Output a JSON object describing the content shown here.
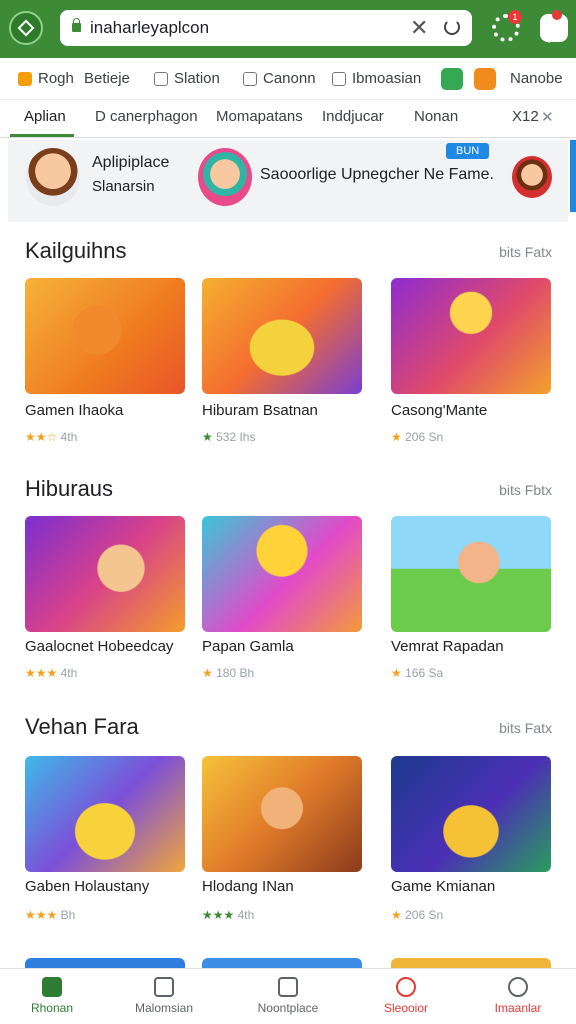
{
  "browser": {
    "url": "inaharleyaplcon",
    "notif_count": "1"
  },
  "categories": [
    {
      "label": "Rogh",
      "icon": "app-icon"
    },
    {
      "label": "Betieje",
      "icon": "grid-icon"
    },
    {
      "label": "Slation",
      "icon": "image-icon"
    },
    {
      "label": "Canonn",
      "icon": "camera-icon"
    },
    {
      "label": "Ibmoasian",
      "icon": "box-icon"
    },
    {
      "label": "Nanobe",
      "icon": "more-icon"
    }
  ],
  "tabs": [
    {
      "label": "Aplian"
    },
    {
      "label": "D canerphagon"
    },
    {
      "label": "Momapatans"
    },
    {
      "label": "Inddjucar"
    },
    {
      "label": "Nonan"
    },
    {
      "label": "X12"
    }
  ],
  "banner": {
    "title": "Aplipiplace",
    "subtitle": "Slanarsin",
    "middle_text": "Saooorlige Upnegcher Ne Fame.",
    "badge": "BUN"
  },
  "sections": [
    {
      "title": "Kailguihns",
      "more": "bits Fatx",
      "cards": [
        {
          "title": "Gamen Ihaoka",
          "stars": "★★☆",
          "rating": "4th"
        },
        {
          "title": "Hiburam Bsatnan",
          "stars": "★",
          "rating": "532 Ihs"
        },
        {
          "title": "Casong'Mante",
          "stars": "★",
          "rating": "206 Sn"
        }
      ]
    },
    {
      "title": "Hiburaus",
      "more": "bits Fbtx",
      "cards": [
        {
          "title": "Gaalocnet Hobeedcay",
          "stars": "★★★",
          "rating": "4th"
        },
        {
          "title": "Papan Gamla",
          "stars": "★",
          "rating": "180 Bh"
        },
        {
          "title": "Vemrat Rapadan",
          "stars": "★",
          "rating": "166 Sa"
        }
      ]
    },
    {
      "title": "Vehan Fara",
      "more": "bits Fatx",
      "cards": [
        {
          "title": "Gaben Holaustany",
          "stars": "★★★",
          "rating": "Bh"
        },
        {
          "title": "Hlodang INan",
          "stars": "★★★",
          "rating": "4th"
        },
        {
          "title": "Game Kmianan",
          "stars": "★",
          "rating": "206 Sn"
        }
      ]
    }
  ],
  "bottom_nav": [
    {
      "label": "Rhonan"
    },
    {
      "label": "Malomsian"
    },
    {
      "label": "Noontplace"
    },
    {
      "label": "Sleooior"
    },
    {
      "label": "Imaanlar"
    }
  ],
  "colors": {
    "brand": "#3d8b37",
    "accent_blue": "#1e88e5",
    "star": "#f4a020",
    "active_nav": "#2e7d32",
    "alert_nav": "#e53935"
  }
}
